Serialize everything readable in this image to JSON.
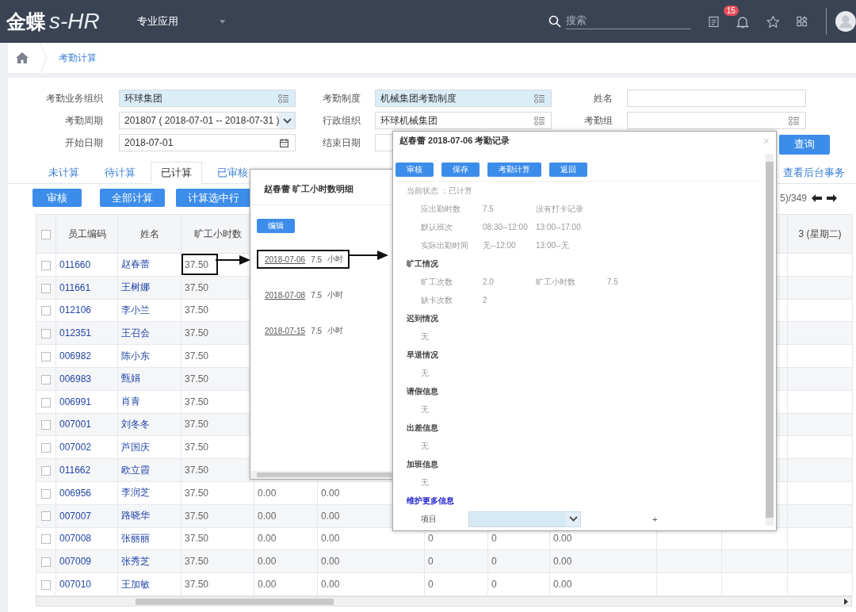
{
  "header": {
    "logo_main": "金蝶",
    "logo_sub": "s-HR",
    "menu": "专业应用",
    "search": {
      "placeholder": "搜索"
    },
    "badge": "15"
  },
  "breadcrumb": [
    "考勤计算"
  ],
  "filters": [
    {
      "label": "考勤业务组织",
      "kind": "lookup",
      "value": "环球集团",
      "highlighted": true
    },
    {
      "label": "考勤制度",
      "kind": "lookup",
      "value": "机械集团考勤制度",
      "highlighted": true
    },
    {
      "label": "姓名",
      "kind": "text",
      "highlighted": false
    },
    {
      "label": "考勤周期",
      "kind": "select",
      "value": "201807 ( 2018-07-01 -- 2018-07-31 )",
      "highlighted": false
    },
    {
      "label": "行政组织",
      "kind": "lookup",
      "value": "环球机械集团",
      "highlighted": false
    },
    {
      "label": "考勤组",
      "kind": "lookup",
      "highlighted": false
    },
    {
      "label": "开始日期",
      "kind": "date",
      "value": "2018-07-01",
      "highlighted": false
    },
    {
      "label": "结束日期",
      "kind": "date",
      "highlighted": false
    }
  ],
  "query_button": "查询",
  "tabs": [
    {
      "label": "未计算",
      "selected": false
    },
    {
      "label": "待计算",
      "selected": false
    },
    {
      "label": "已计算",
      "selected": true
    },
    {
      "label": "已审核",
      "selected": false
    }
  ],
  "task_link": "查看后台事务",
  "actions": [
    "审核",
    "全部计算",
    "计算选中行"
  ],
  "pager": "5)/349",
  "table": {
    "select_all_checked": false,
    "columns": [
      "员工编码",
      "姓名",
      "旷工小时数"
    ],
    "last_column": "3 (星期二)",
    "rows": [
      {
        "code": "011660",
        "name": "赵春蕾",
        "hours": "37.50",
        "marked": true,
        "checked": false,
        "cells": []
      },
      {
        "code": "011661",
        "name": "王树娜",
        "hours": "37.50",
        "marked": false,
        "checked": false,
        "cells": []
      },
      {
        "code": "012106",
        "name": "李小兰",
        "hours": "37.50",
        "marked": false,
        "checked": false,
        "cells": []
      },
      {
        "code": "012351",
        "name": "王召会",
        "hours": "37.50",
        "marked": false,
        "checked": false,
        "cells": []
      },
      {
        "code": "006982",
        "name": "陈小东",
        "hours": "37.50",
        "marked": false,
        "checked": false,
        "cells": []
      },
      {
        "code": "006983",
        "name": "甄娟",
        "hours": "37.50",
        "marked": false,
        "checked": false,
        "cells": []
      },
      {
        "code": "006991",
        "name": "肖青",
        "hours": "37.50",
        "marked": false,
        "checked": false,
        "cells": []
      },
      {
        "code": "007001",
        "name": "刘冬冬",
        "hours": "37.50",
        "marked": false,
        "checked": false,
        "cells": []
      },
      {
        "code": "007002",
        "name": "芦国庆",
        "hours": "37.50",
        "marked": false,
        "checked": false,
        "cells": []
      },
      {
        "code": "011662",
        "name": "欧立霞",
        "hours": "37.50",
        "marked": false,
        "checked": false,
        "cells": []
      },
      {
        "code": "006956",
        "name": "李润芝",
        "hours": "37.50",
        "marked": false,
        "checked": false,
        "cells": [
          "0.00",
          "0.00"
        ]
      },
      {
        "code": "007007",
        "name": "路晓华",
        "hours": "37.50",
        "marked": false,
        "checked": false,
        "cells": [
          "0.00",
          "0.00"
        ]
      },
      {
        "code": "007008",
        "name": "张丽丽",
        "hours": "37.50",
        "marked": false,
        "checked": false,
        "cells": [
          "0.00",
          "0.00",
          "0",
          "0",
          "0.00"
        ]
      },
      {
        "code": "007009",
        "name": "张秀芝",
        "hours": "37.50",
        "marked": false,
        "checked": false,
        "cells": [
          "0.00",
          "0.00",
          "0",
          "0",
          "0.00"
        ]
      },
      {
        "code": "007010",
        "name": "王加敏",
        "hours": "37.50",
        "marked": false,
        "checked": false,
        "cells": [
          "0.00",
          "0.00",
          "0",
          "0",
          "0.00"
        ]
      }
    ]
  },
  "detail_dialog": {
    "title": "赵春蕾 旷工小时数明细",
    "button": "编辑",
    "entries": [
      {
        "date": "2018-07-06",
        "hours": "7.5",
        "unit": "小时",
        "marked": true
      },
      {
        "date": "2018-07-08",
        "hours": "7.5",
        "unit": "小时",
        "marked": false
      },
      {
        "date": "2018-07-15",
        "hours": "7.5",
        "unit": "小时",
        "marked": false
      }
    ]
  },
  "record_dialog": {
    "title": "赵春蕾 2018-07-06 考勤记录",
    "close": "×",
    "buttons": [
      "审核",
      "保存",
      "考勤计算",
      "返回"
    ],
    "status": "当前状态 ：已计算",
    "summary": [
      [
        "应出勤时数",
        "7.5",
        "没有打卡记录"
      ],
      [
        "默认班次",
        "08:30--12:00",
        "13:00--17:00"
      ],
      [
        "实际出勤时间",
        "无--12:00",
        "13:00--无"
      ]
    ],
    "sections": [
      {
        "title": "旷工情况",
        "rows": [
          [
            "旷工次数",
            "2.0",
            "旷工小时数",
            "7.5"
          ],
          [
            "缺卡次数",
            "2"
          ]
        ]
      },
      {
        "title": "迟到情况",
        "rows": [
          [
            "无"
          ]
        ]
      },
      {
        "title": "早退情况",
        "rows": [
          [
            "无"
          ]
        ]
      },
      {
        "title": "请假信息",
        "rows": [
          [
            "无"
          ]
        ]
      },
      {
        "title": "出差信息",
        "rows": [
          [
            "无"
          ]
        ]
      },
      {
        "title": "加班信息",
        "rows": [
          [
            "无"
          ]
        ]
      }
    ],
    "more_link": "维护更多信息",
    "item_label": "项目",
    "add": "+"
  }
}
